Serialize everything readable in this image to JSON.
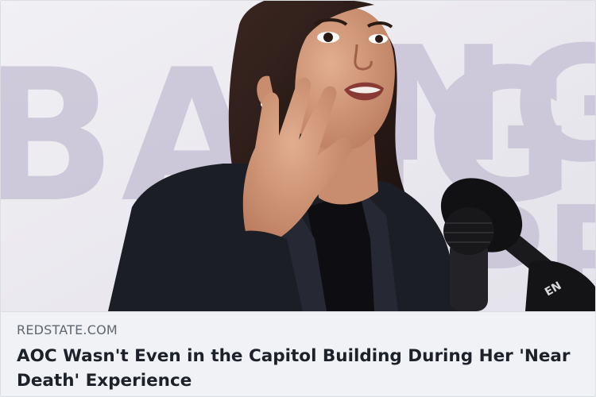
{
  "link_preview": {
    "image": {
      "icon": "news-photo",
      "background_text": "BANG"
    },
    "domain": "REDSTATE.COM",
    "headline": "AOC Wasn't Even in the Capitol Building During Her 'Near Death' Experience"
  },
  "colors": {
    "caption_background": "#f0f2f5",
    "domain_text": "#606770",
    "headline_text": "#1d2129",
    "backdrop_lettering": "#c8c3d6"
  }
}
